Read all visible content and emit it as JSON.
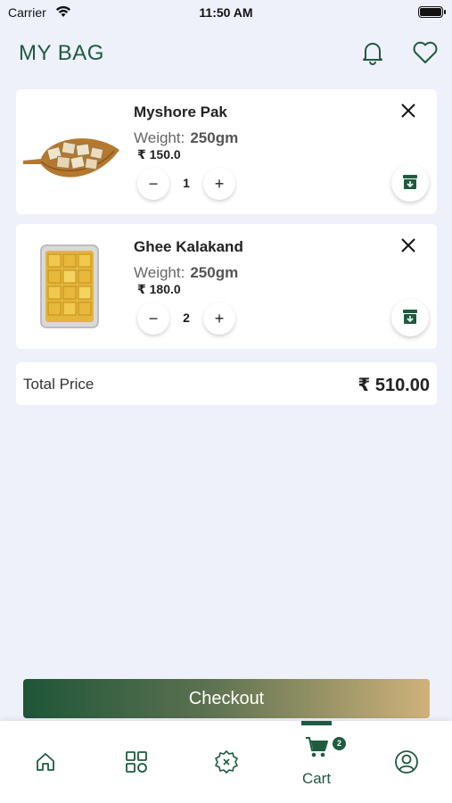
{
  "status": {
    "carrier": "Carrier",
    "time": "11:50 AM"
  },
  "header": {
    "title": "MY BAG"
  },
  "items": [
    {
      "name": "Myshore Pak",
      "weight_label": "Weight:",
      "weight": "250gm",
      "price": "₹ 150.0",
      "quantity": "1"
    },
    {
      "name": "Ghee Kalakand",
      "weight_label": "Weight:",
      "weight": "250gm",
      "price": "₹ 180.0",
      "quantity": "2"
    }
  ],
  "qty_controls": {
    "minus": "−",
    "plus": "+"
  },
  "total": {
    "label": "Total Price",
    "value": "₹ 510.00"
  },
  "checkout": {
    "label": "Checkout"
  },
  "tabbar": {
    "active": "cart",
    "cart_label": "Cart",
    "cart_badge": "2",
    "icons": [
      "home-icon",
      "categories-icon",
      "offers-icon",
      "cart-icon",
      "profile-icon"
    ]
  },
  "colors": {
    "brand": "#1e5b3f",
    "gold": "#cfb27a",
    "background": "#eef1fa"
  }
}
